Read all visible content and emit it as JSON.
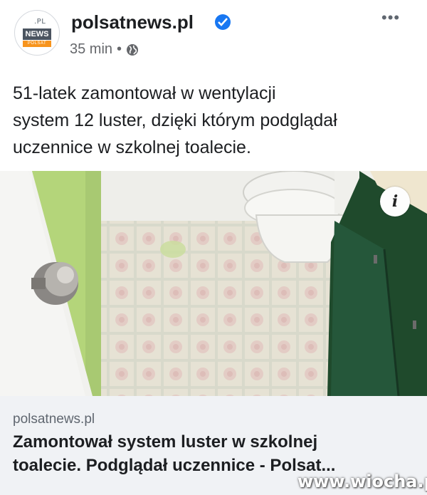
{
  "post": {
    "source_name": "polsatnews.pl",
    "time": "35 min",
    "separator": "•",
    "text": "51-latek zamontował w wentylacji\nsystem 12 luster, dzięki którym podglądał\nuczennice w szkolnej toalecie."
  },
  "avatar": {
    "top": ".PL",
    "middle": "NEWS",
    "bottom": "POLSAT"
  },
  "header": {
    "more": "•••"
  },
  "photo": {
    "info_label": "i"
  },
  "link": {
    "domain": "polsatnews.pl",
    "title": "Zamontował system luster w szkolnej\ntoalecie. Podglądał uczennice - Polsat..."
  },
  "watermark": "www.wiocha.pl",
  "colors": {
    "verified": "#1877f2",
    "card_bg": "#f0f2f5",
    "cabinet": "#1f4a2c",
    "wall": "#b5d67a"
  }
}
